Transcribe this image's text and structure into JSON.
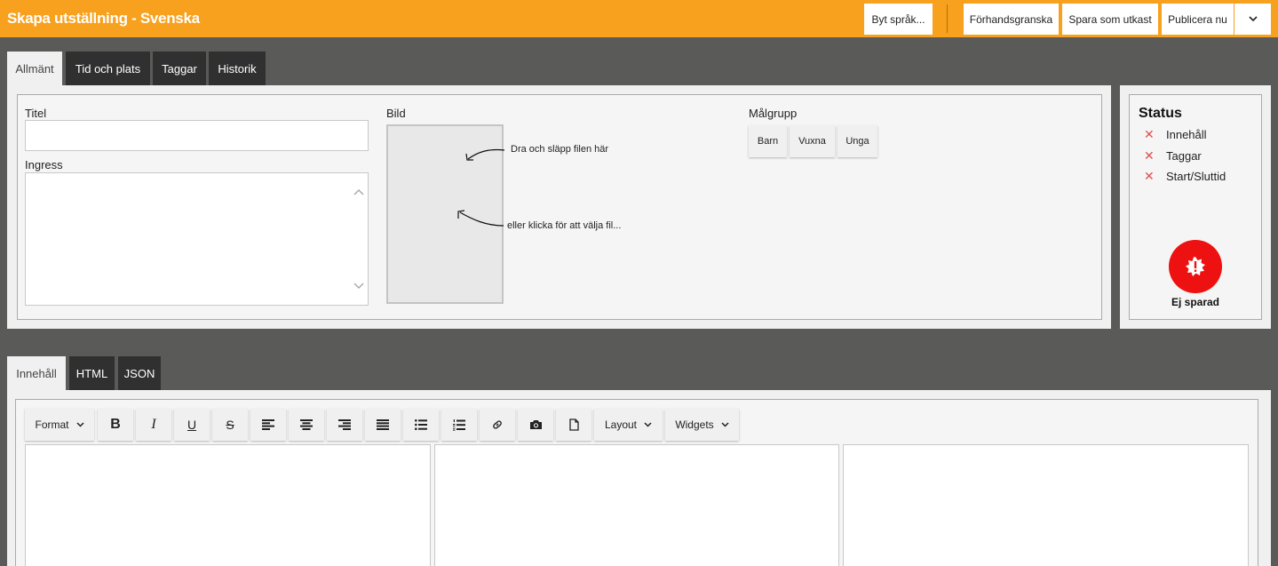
{
  "header": {
    "title": "Skapa utställning - Svenska",
    "change_language": "Byt språk...",
    "preview": "Förhandsgranska",
    "save_draft": "Spara som utkast",
    "publish": "Publicera nu",
    "dropdown_icon": "chevron-down-icon"
  },
  "top_tabs": [
    "Allmänt",
    "Tid och plats",
    "Taggar",
    "Historik"
  ],
  "general": {
    "title_label": "Titel",
    "title_value": "",
    "ingress_label": "Ingress",
    "ingress_value": "",
    "image_label": "Bild",
    "drop_text": "Dra och släpp filen här",
    "click_text": "eller klicka för att välja fil...",
    "audience_label": "Målgrupp",
    "audience": [
      "Barn",
      "Vuxna",
      "Unga"
    ]
  },
  "status": {
    "title": "Status",
    "items": [
      "Innehåll",
      "Taggar",
      "Start/Sluttid"
    ],
    "badge_label": "Ej sparad",
    "colors": {
      "header": "#f7a11e",
      "error": "#ee1111",
      "cross": "#e05050"
    }
  },
  "content_tabs": [
    "Innehåll",
    "HTML",
    "JSON"
  ],
  "toolbar": {
    "format": "Format",
    "bold": "B",
    "italic": "I",
    "underline": "U",
    "strike": "S",
    "layout": "Layout",
    "widgets": "Widgets"
  }
}
